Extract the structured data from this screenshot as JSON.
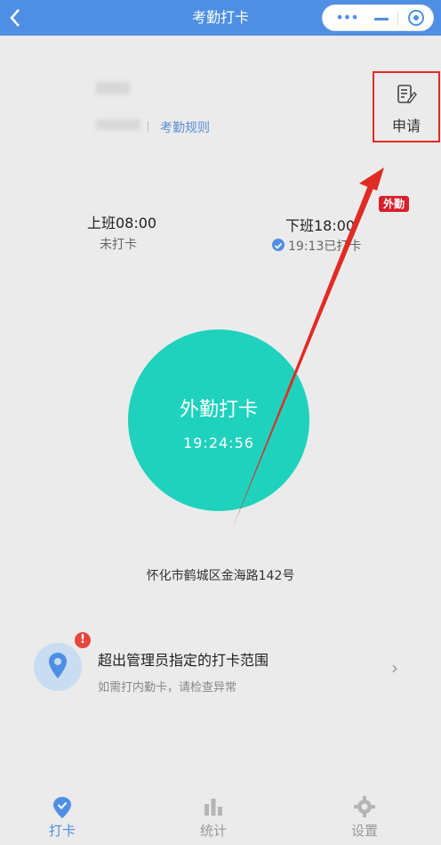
{
  "header": {
    "title": "考勤打卡",
    "capsule": {
      "more_icon": "more-dots-icon",
      "minimize_icon": "minimize-icon",
      "close_icon": "close-circle-icon"
    }
  },
  "user": {
    "rules_link": "考勤规则"
  },
  "apply": {
    "label": "申请",
    "icon": "edit-note-icon",
    "highlight_color": "#e02b24"
  },
  "badge": {
    "label": "外勤",
    "color": "#d8212b"
  },
  "shifts": [
    {
      "title": "上班08:00",
      "status": "未打卡"
    },
    {
      "title": "下班18:00",
      "status": "19:13已打卡",
      "status_icon": "check-circle-icon"
    }
  ],
  "punch": {
    "label": "外勤打卡",
    "time": "19:24:56",
    "color": "#1ed2bd"
  },
  "location": {
    "address": "怀化市鹤城区金海路142号"
  },
  "notice": {
    "title": "超出管理员指定的打卡范围",
    "subtitle": "如需打内勤卡，请检查异常",
    "alert": "!"
  },
  "tabs": [
    {
      "label": "打卡",
      "icon": "checkin-pin-icon",
      "active": true
    },
    {
      "label": "统计",
      "icon": "bar-chart-icon",
      "active": false
    },
    {
      "label": "设置",
      "icon": "gear-icon",
      "active": false
    }
  ],
  "colors": {
    "primary": "#4e8fe4",
    "annotation_arrow": "#e02b24"
  }
}
